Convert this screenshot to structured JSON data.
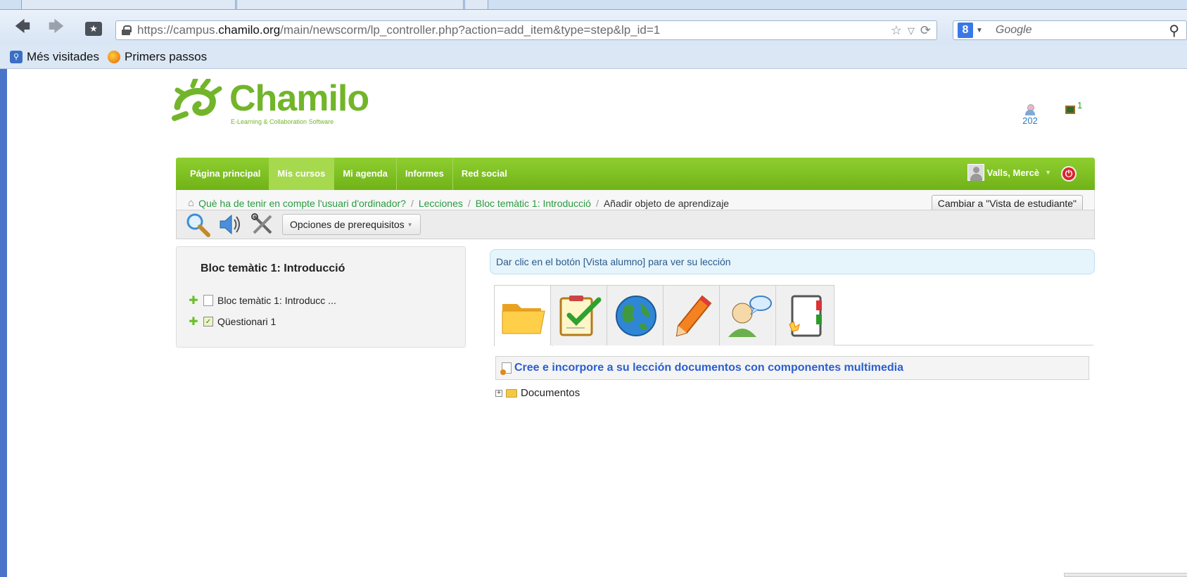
{
  "browser": {
    "url_prefix": "https://campus.",
    "url_domain": "chamilo.org",
    "url_suffix": "/main/newscorm/lp_controller.php?action=add_item&type=step&lp_id=1",
    "search_engine_badge": "8",
    "search_placeholder": "Google",
    "bookmarks": [
      {
        "label": "Més visitades",
        "icon": "bookmark-icon"
      },
      {
        "label": "Primers passos",
        "icon": "firefox-icon"
      }
    ],
    "accent_color": "#4a74c9"
  },
  "site": {
    "logo_text": "Chamilo",
    "logo_tagline": "E-Learning & Collaboration Software",
    "users_online": "202",
    "courses_count": "1",
    "brand_color": "#72b52a"
  },
  "menu": {
    "items": [
      {
        "label": "Página principal",
        "active": false
      },
      {
        "label": "Mis cursos",
        "active": true
      },
      {
        "label": "Mi agenda",
        "active": false
      },
      {
        "label": "Informes",
        "active": false
      },
      {
        "label": "Red social",
        "active": false
      }
    ],
    "user_name": "Valls, Mercè"
  },
  "breadcrumb": {
    "items": [
      "Què ha de tenir en compte l'usuari d'ordinador?",
      "Lecciones",
      "Bloc temàtic 1: Introducció"
    ],
    "current": "Añadir objeto de aprendizaje",
    "switch_button": "Cambiar a \"Vista de estudiante\""
  },
  "toolbar": {
    "prerequisites_label": "Opciones de prerequisitos"
  },
  "sidebar": {
    "title": "Bloc temàtic 1: Introducció",
    "items": [
      {
        "label": "Bloc temàtic 1: Introducc ...",
        "icon": "document-icon"
      },
      {
        "label": "Qüestionari 1",
        "icon": "quiz-icon"
      }
    ]
  },
  "main": {
    "info_message": "Dar clic en el botón [Vista alumno] para ver su lección",
    "tabs": [
      {
        "icon": "folder-icon",
        "active": true
      },
      {
        "icon": "exercise-icon",
        "active": false
      },
      {
        "icon": "globe-icon",
        "active": false
      },
      {
        "icon": "pencil-icon",
        "active": false
      },
      {
        "icon": "chat-user-icon",
        "active": false
      },
      {
        "icon": "book-icon",
        "active": false
      }
    ],
    "create_link": "Cree e incorpore a su lección documentos con componentes multimedia",
    "tree_root": "Documentos"
  }
}
